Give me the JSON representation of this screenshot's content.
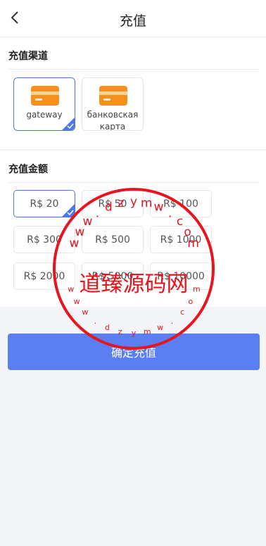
{
  "header": {
    "title": "充值"
  },
  "channels": {
    "title": "充值渠道",
    "items": [
      {
        "label": "gateway",
        "selected": true
      },
      {
        "label": "банковская карта",
        "selected": false
      }
    ]
  },
  "amounts": {
    "title": "充值金额",
    "items": [
      {
        "label": "R$ 20",
        "selected": true
      },
      {
        "label": "R$ 50",
        "selected": false
      },
      {
        "label": "R$ 100",
        "selected": false
      },
      {
        "label": "R$ 300",
        "selected": false
      },
      {
        "label": "R$ 500",
        "selected": false
      },
      {
        "label": "R$ 1000",
        "selected": false
      },
      {
        "label": "R$ 2000",
        "selected": false
      },
      {
        "label": "R$ 5000",
        "selected": false
      },
      {
        "label": "R$ 10000",
        "selected": false
      }
    ]
  },
  "confirm_button": {
    "label": "确定充值"
  },
  "watermark": {
    "center_text": "道臻源码网",
    "url_text": "www.dzymw.com",
    "color": "#e8141e"
  },
  "colors": {
    "accent": "#5b7ef2",
    "selected_border": "#4d79e6",
    "card_icon": "#f5901f"
  },
  "icons": {
    "back": "chevron-left-icon",
    "card": "credit-card-icon",
    "check": "check-corner-icon"
  }
}
